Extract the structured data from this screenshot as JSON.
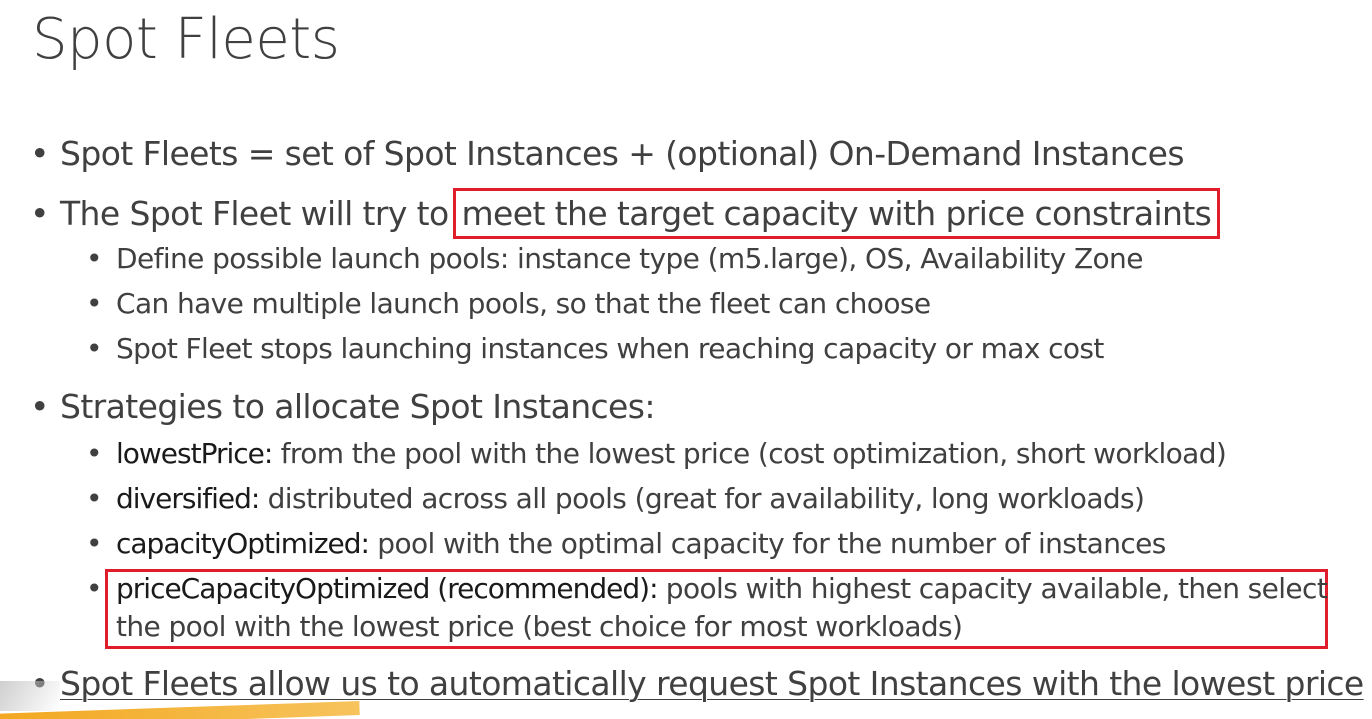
{
  "title": "Spot Fleets",
  "bullets": {
    "b1": "Spot Fleets = set of Spot Instances + (optional) On-Demand Instances",
    "b2_prefix": "The Spot Fleet will try to ",
    "b2_highlight": "meet the target capacity with price constraints",
    "b2_sub": [
      "Define possible launch pools: instance type (m5.large), OS, Availability Zone",
      "Can have multiple launch pools, so that the fleet can choose",
      "Spot Fleet stops launching instances when reaching capacity or max cost"
    ],
    "b3": "Strategies to allocate Spot Instances:",
    "b3_sub": [
      {
        "term": "lowestPrice:",
        "text": " from the pool with the lowest price (cost optimization, short workload)"
      },
      {
        "term": "diversified:",
        "text": " distributed across all pools (great for availability, long workloads)"
      },
      {
        "term": "capacityOptimized:",
        "text": " pool with the optimal capacity for the number of instances"
      },
      {
        "term": "priceCapacityOptimized (recommended):",
        "text": " pools with highest capacity available, then select",
        "text_line2": "the pool with the lowest price (best choice for most workloads)"
      }
    ],
    "b4": "Spot Fleets allow us to automatically request Spot Instances with the lowest price"
  },
  "colors": {
    "text": "#404040",
    "highlight_border": "#e01e2b",
    "accent": "#f2a51a"
  }
}
